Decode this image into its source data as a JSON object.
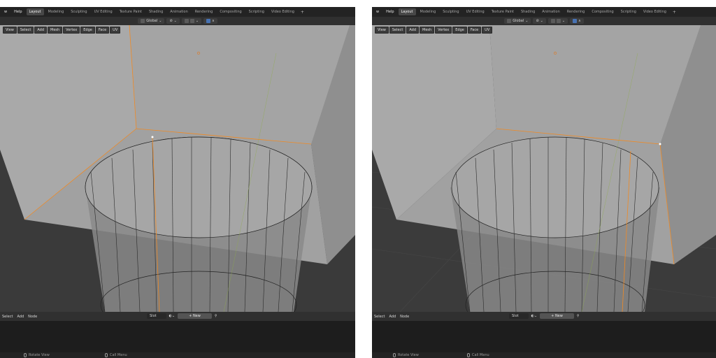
{
  "left_pane": {
    "menus": [
      "w",
      "Help"
    ],
    "tabs": [
      "Layout",
      "Modeling",
      "Sculpting",
      "UV Editing",
      "Texture Paint",
      "Shading",
      "Animation",
      "Rendering",
      "Compositing",
      "Scripting",
      "Video Editing"
    ],
    "active_tab": "Layout",
    "header": {
      "orientation": "Global"
    },
    "viewport_menu": [
      "View",
      "Select",
      "Add",
      "Mesh",
      "Vertex",
      "Edge",
      "Face",
      "UV"
    ],
    "node_menu": [
      "Select",
      "Add",
      "Node"
    ],
    "slot_label": "Slot",
    "new_label": "New",
    "status": {
      "left_action": "Rotate View",
      "right_action": "Call Menu"
    }
  },
  "right_pane": {
    "menus": [
      "w",
      "Help"
    ],
    "tabs": [
      "Layout",
      "Modeling",
      "Sculpting",
      "UV Editing",
      "Texture Paint",
      "Shading",
      "Animation",
      "Rendering",
      "Compositing",
      "Scripting",
      "Video Editing"
    ],
    "active_tab": "Layout",
    "header": {
      "orientation": "Global"
    },
    "viewport_menu": [
      "View",
      "Select",
      "Add",
      "Mesh",
      "Vertex",
      "Edge",
      "Face",
      "UV"
    ],
    "node_menu": [
      "Select",
      "Add",
      "Node"
    ],
    "slot_label": "Slot",
    "new_label": "New",
    "status": {
      "left_action": "Rotate View",
      "right_action": "Call Menu"
    }
  },
  "colors": {
    "selection_edge": "#f08a24",
    "active_tab_bg": "#474747",
    "mesh_face": "#a5a5a5",
    "grid_bg": "#3b3b3b"
  },
  "icons": {
    "add_workspace": "plus-icon",
    "pin": "pin-icon",
    "mouse": "mouse-icon"
  }
}
